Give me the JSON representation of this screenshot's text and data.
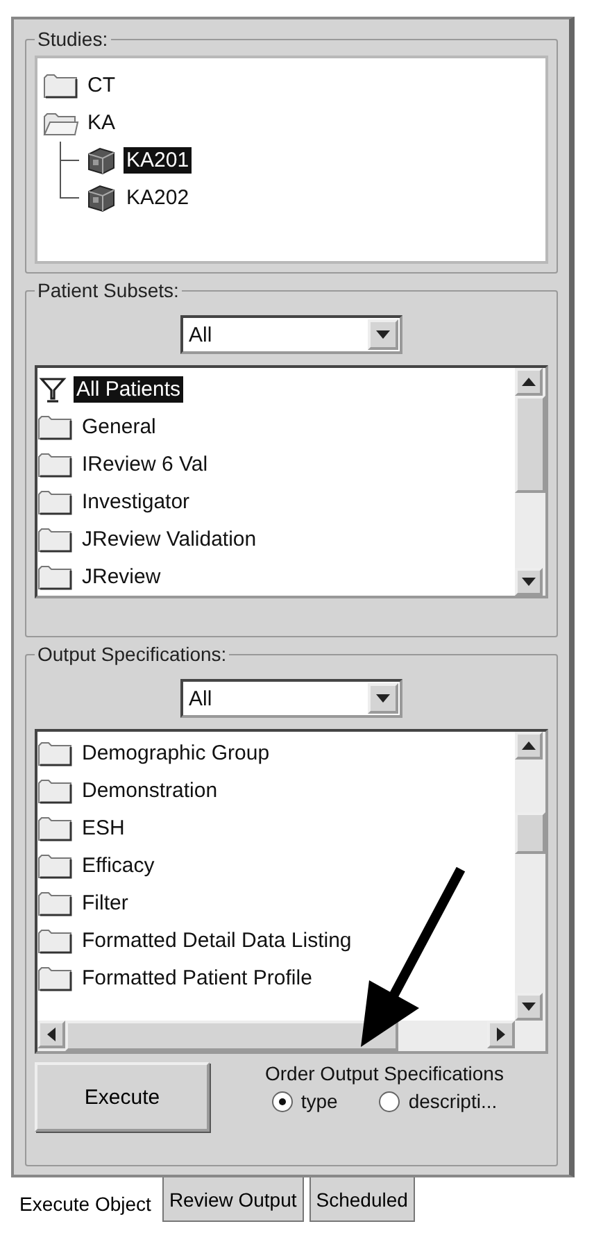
{
  "studies": {
    "label": "Studies:",
    "tree": [
      {
        "label": "CT",
        "kind": "folder",
        "expanded": false,
        "selected": false
      },
      {
        "label": "KA",
        "kind": "folder",
        "expanded": true,
        "selected": false,
        "children": [
          {
            "label": "KA201",
            "kind": "study",
            "selected": true
          },
          {
            "label": "KA202",
            "kind": "study",
            "selected": false
          }
        ]
      }
    ]
  },
  "patient_subsets": {
    "label": "Patient Subsets:",
    "filter": {
      "value": "All"
    },
    "items": [
      {
        "label": "All Patients",
        "kind": "filter",
        "selected": true
      },
      {
        "label": "General",
        "kind": "folder",
        "selected": false
      },
      {
        "label": "IReview 6 Val",
        "kind": "folder",
        "selected": false
      },
      {
        "label": "Investigator",
        "kind": "folder",
        "selected": false
      },
      {
        "label": "JReview Validation",
        "kind": "folder",
        "selected": false
      },
      {
        "label": "JReview",
        "kind": "folder",
        "selected": false
      }
    ]
  },
  "output_specifications": {
    "label": "Output Specifications:",
    "filter": {
      "value": "All"
    },
    "items": [
      {
        "label": "Demographic Group",
        "kind": "folder",
        "selected": false
      },
      {
        "label": "Demonstration",
        "kind": "folder",
        "selected": false
      },
      {
        "label": "ESH",
        "kind": "folder",
        "selected": false
      },
      {
        "label": "Efficacy",
        "kind": "folder",
        "selected": false
      },
      {
        "label": "Filter",
        "kind": "folder",
        "selected": false
      },
      {
        "label": "Formatted Detail Data Listing",
        "kind": "folder",
        "selected": false
      },
      {
        "label": "Formatted Patient Profile",
        "kind": "folder",
        "selected": false
      }
    ]
  },
  "execute_button": {
    "label": "Execute"
  },
  "order": {
    "label": "Order Output Specifications",
    "options": [
      {
        "label": "type",
        "selected": true
      },
      {
        "label": "descripti...",
        "selected": false
      }
    ]
  },
  "tabs": [
    {
      "label": "Execute Object",
      "selected": true
    },
    {
      "label": "Review Output",
      "selected": false
    },
    {
      "label": "Scheduled",
      "selected": false
    }
  ]
}
